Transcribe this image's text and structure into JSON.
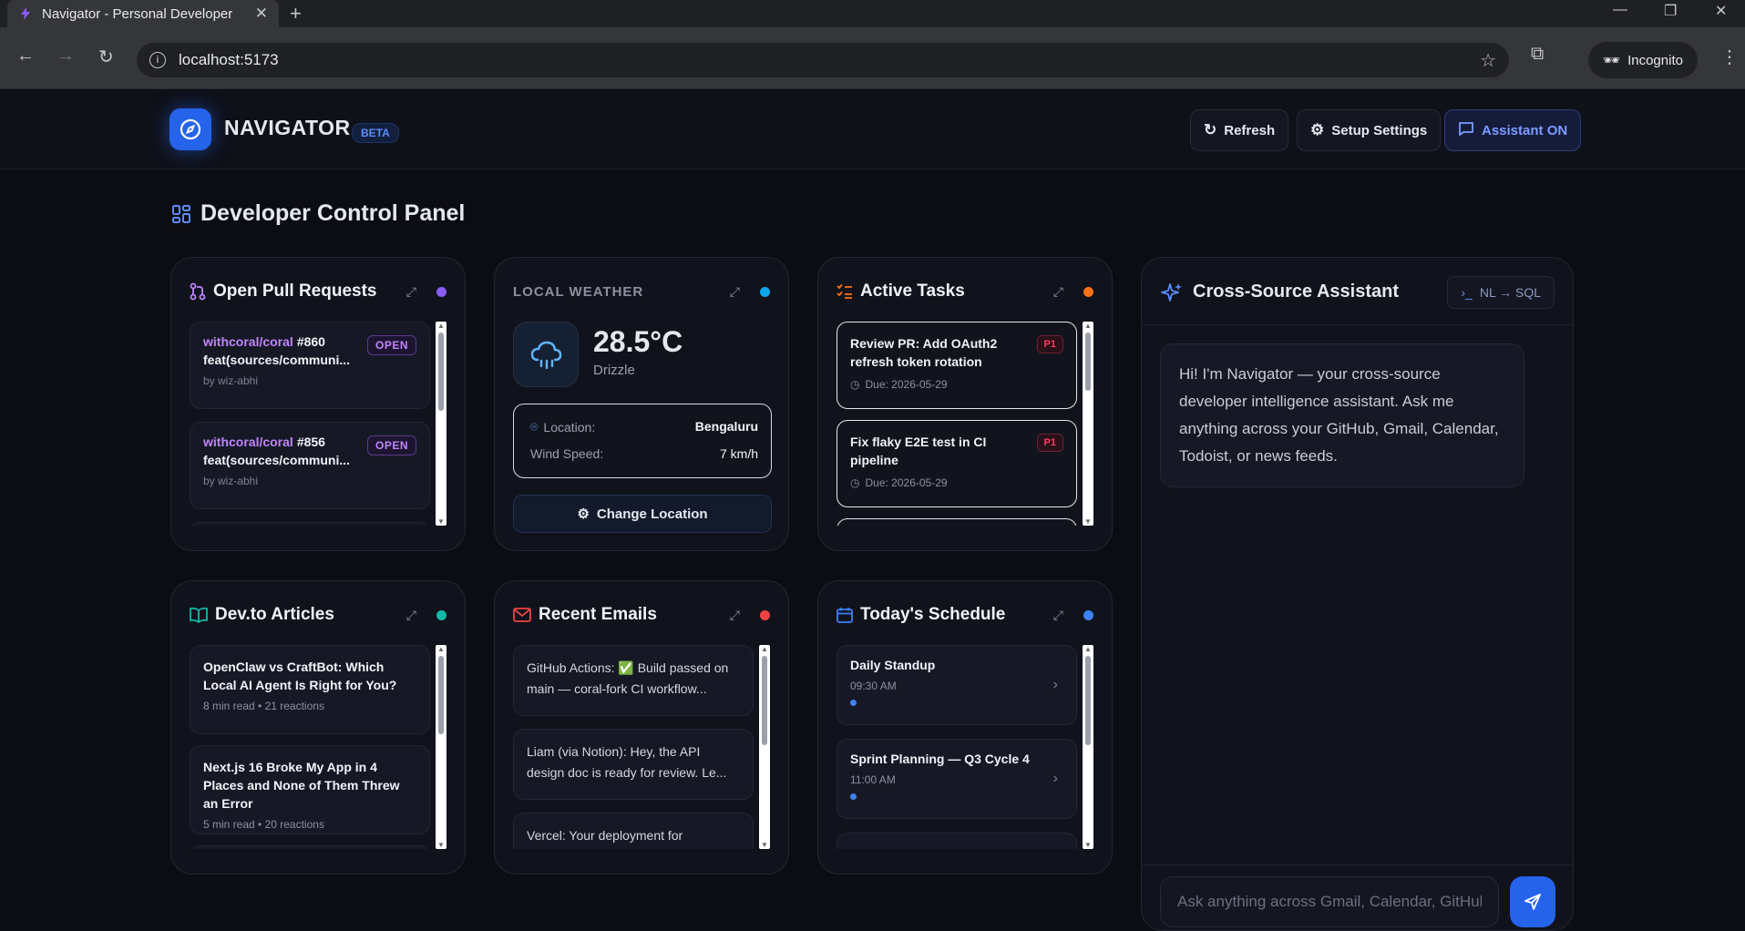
{
  "browser": {
    "tab_title": "Navigator - Personal Developer",
    "url": "localhost:5173",
    "profile": "Incognito"
  },
  "header": {
    "brand": "NAVIGATOR",
    "badge": "BETA",
    "refresh": "Refresh",
    "settings": "Setup Settings",
    "assistant_toggle": "Assistant ON"
  },
  "page_title": "Developer Control Panel",
  "pull_requests": {
    "title": "Open Pull Requests",
    "dot_color": "#8b5cf6",
    "items": [
      {
        "repo": "withcoral/coral",
        "number": "#860",
        "title": "feat(sources/communi...",
        "author": "by wiz-abhi",
        "status": "OPEN"
      },
      {
        "repo": "withcoral/coral",
        "number": "#856",
        "title": "feat(sources/communi...",
        "author": "by wiz-abhi",
        "status": "OPEN"
      }
    ]
  },
  "weather": {
    "title": "LOCAL WEATHER",
    "dot_color": "#0ea5e9",
    "temperature": "28.5°C",
    "condition": "Drizzle",
    "location_label": "Location:",
    "location": "Bengaluru",
    "wind_label": "Wind Speed:",
    "wind": "7 km/h",
    "button": "Change Location"
  },
  "tasks": {
    "title": "Active Tasks",
    "dot_color": "#f97316",
    "items": [
      {
        "title": "Review PR: Add OAuth2 refresh token rotation",
        "priority": "P1",
        "due": "Due: 2026-05-29"
      },
      {
        "title": "Fix flaky E2E test in CI pipeline",
        "priority": "P1",
        "due": "Due: 2026-05-29"
      }
    ]
  },
  "articles": {
    "title": "Dev.to Articles",
    "dot_color": "#14b8a6",
    "items": [
      {
        "title": "OpenClaw vs CraftBot: Which Local AI Agent Is Right for You?",
        "meta": "8 min read • 21 reactions"
      },
      {
        "title": "Next.js 16 Broke My App in 4 Places and None of Them Threw an Error",
        "meta": "5 min read • 20 reactions"
      }
    ]
  },
  "emails": {
    "title": "Recent Emails",
    "dot_color": "#ef4444",
    "items": [
      {
        "text": "GitHub Actions: ✅ Build passed on main — coral-fork CI workflow..."
      },
      {
        "text": "Liam (via Notion): Hey, the API design doc is ready for review. Le..."
      },
      {
        "text": "Vercel: Your deployment for"
      }
    ]
  },
  "schedule": {
    "title": "Today's Schedule",
    "dot_color": "#3b82f6",
    "items": [
      {
        "title": "Daily Standup",
        "time": "09:30 AM"
      },
      {
        "title": "Sprint Planning — Q3 Cycle 4",
        "time": "11:00 AM"
      }
    ]
  },
  "assistant": {
    "title": "Cross-Source Assistant",
    "mode": "NL → SQL",
    "greeting": "Hi! I'm Navigator — your cross-source developer intelligence assistant. Ask me anything across your GitHub, Gmail, Calendar, Todoist, or news feeds.",
    "input_placeholder": "Ask anything across Gmail, Calendar, GitHub..."
  }
}
